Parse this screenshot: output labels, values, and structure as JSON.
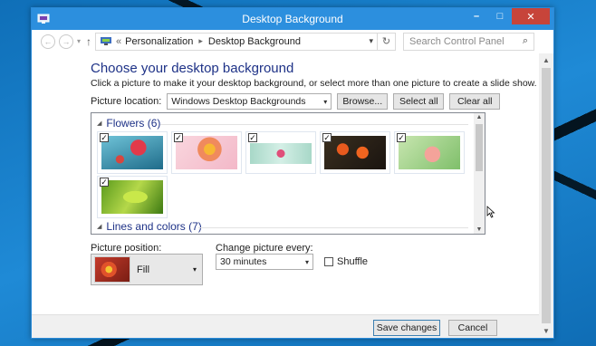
{
  "window": {
    "title": "Desktop Background",
    "minimize": "–",
    "maximize": "□",
    "close": "✕"
  },
  "address": {
    "back": "←",
    "forward": "→",
    "dropdown": "▾",
    "up": "↑",
    "crumb_prefix": "«",
    "crumb_1": "Personalization",
    "crumb_sep": "▸",
    "crumb_2": "Desktop Background",
    "refresh": "↻",
    "search_placeholder": "Search Control Panel",
    "search_icon": "⌕"
  },
  "main": {
    "heading": "Choose your desktop background",
    "subtitle": "Click a picture to make it your desktop background, or select more than one picture to create a slide show.",
    "location_label": "Picture location:",
    "location_value": "Windows Desktop Backgrounds",
    "browse_label": "Browse...",
    "select_all_label": "Select all",
    "clear_all_label": "Clear all"
  },
  "gallery": {
    "groups": [
      {
        "title": "Flowers (6)"
      },
      {
        "title": "Lines and colors (7)"
      }
    ],
    "checkmark": "✓",
    "flowers": [
      {
        "name": "Red flower on teal",
        "checked": true
      },
      {
        "name": "Pink daisy",
        "checked": true
      },
      {
        "name": "Pink blossom",
        "checked": true
      },
      {
        "name": "Orange tulips dark",
        "checked": true
      },
      {
        "name": "Pink lily on green",
        "checked": true
      },
      {
        "name": "Green leaf",
        "checked": true
      }
    ]
  },
  "options": {
    "position_label": "Picture position:",
    "position_value": "Fill",
    "change_label": "Change picture every:",
    "change_value": "30 minutes",
    "shuffle_label": "Shuffle",
    "shuffle_checked": false
  },
  "footer": {
    "save_label": "Save changes",
    "cancel_label": "Cancel"
  },
  "colors": {
    "titlebar": "#2c8fde",
    "heading": "#1e3287",
    "close": "#c7443a"
  }
}
